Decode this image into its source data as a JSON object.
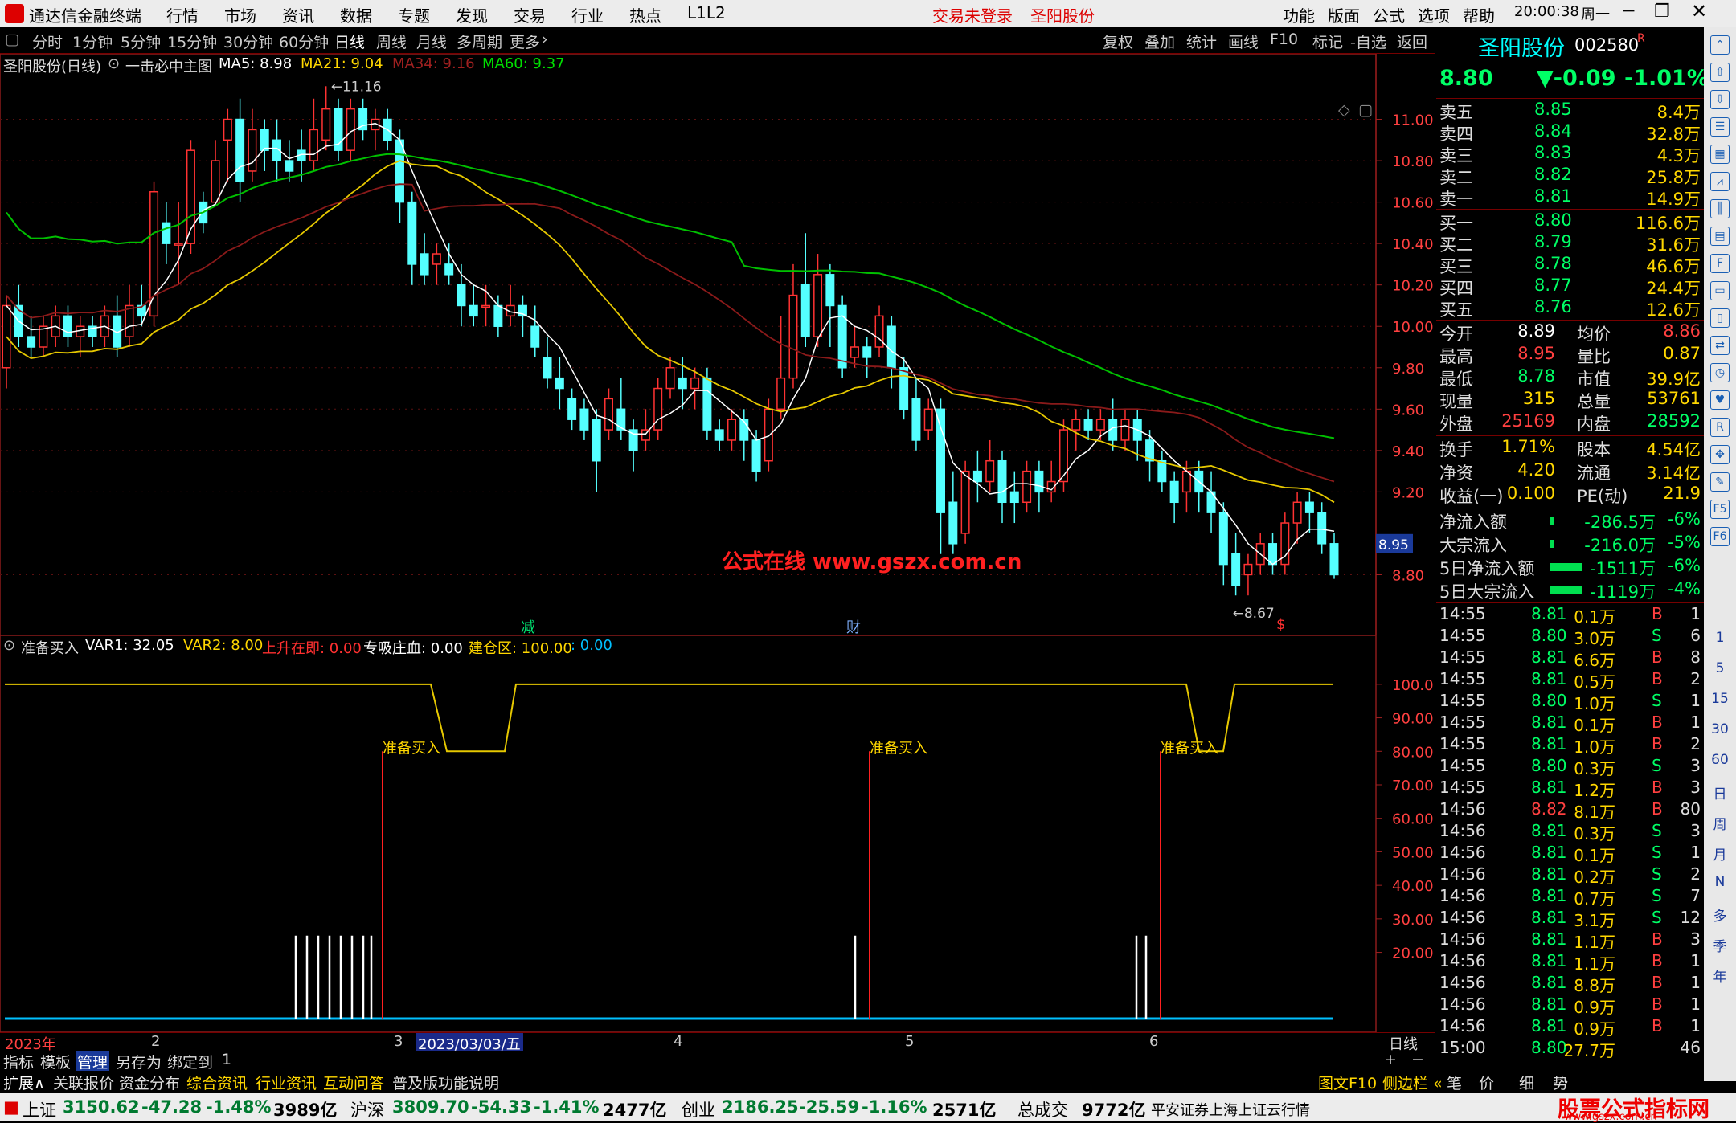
{
  "titlebar": {
    "app_name": "通达信金融终端",
    "menu": [
      "行情",
      "市场",
      "资讯",
      "数据",
      "专题",
      "发现",
      "交易",
      "行业",
      "热点",
      "L1L2"
    ],
    "login_status": "交易未登录",
    "stock_name": "圣阳股份",
    "right_menu": [
      "功能",
      "版面",
      "公式",
      "选项",
      "帮助"
    ],
    "time": "20:00:38",
    "weekday": "周一"
  },
  "periods": [
    "分时",
    "1分钟",
    "5分钟",
    "15分钟",
    "30分钟",
    "60分钟",
    "日线",
    "周线",
    "月线",
    "多周期",
    "更多"
  ],
  "selected_period": "日线",
  "toolbar": [
    "复权",
    "叠加",
    "统计",
    "画线",
    "F10",
    "标记",
    "-自选",
    "返回"
  ],
  "main_legend": {
    "title": "圣阳股份(日线)",
    "indicator": "一击必中主图",
    "ma5": "MA5: 8.98",
    "ma21": "MA21: 9.04",
    "ma34": "MA34: 9.16",
    "ma60": "MA60: 9.37"
  },
  "price_axis": [
    "11.00",
    "10.80",
    "10.60",
    "10.40",
    "10.20",
    "10.00",
    "9.80",
    "9.60",
    "9.40",
    "9.20",
    "8.80"
  ],
  "current_price_tag": "8.95",
  "high_label": "11.16",
  "low_label": "8.67",
  "watermark": "公式在线  www.gszx.com.cn",
  "event_marks": {
    "jian": "减",
    "cai": "财"
  },
  "sub_legend": {
    "name": "准备买入",
    "var1": "VAR1: 32.05",
    "var2": "VAR2: 8.00",
    "up": "上升在即: 0.00",
    "absorb": "专吸庄血: 0.00",
    "build": "建仓区: 100.00",
    "extra": ": 0.00"
  },
  "sub_axis": [
    "100.0",
    "90.00",
    "80.00",
    "70.00",
    "60.00",
    "50.00",
    "40.00",
    "30.00",
    "20.00"
  ],
  "buy_signal_label": "准备买入",
  "timeline": {
    "year": "2023年",
    "m2": "2",
    "m3": "3",
    "highlight": "2023/03/03/五",
    "m4": "4",
    "m5": "5",
    "m6": "6",
    "period": "日线"
  },
  "tabs": [
    "指标",
    "模板",
    "管理",
    "另存为",
    "绑定到",
    "1"
  ],
  "ext_tabs": [
    "扩展∧",
    "关联报价",
    "资金分布",
    "综合资讯",
    "行业资讯",
    "互动问答",
    "普及版功能说明"
  ],
  "ext_right": [
    "图文F10",
    "侧边栏 «",
    "笔",
    "价",
    "细",
    "势"
  ],
  "quote": {
    "name": "圣阳股份",
    "code": "002580",
    "flag": "R",
    "price": "8.80",
    "change": "▼-0.09",
    "pct": "-1.01%",
    "sell": [
      [
        "卖五",
        "8.85",
        "8.4万"
      ],
      [
        "卖四",
        "8.84",
        "32.8万"
      ],
      [
        "卖三",
        "8.83",
        "4.3万"
      ],
      [
        "卖二",
        "8.82",
        "25.8万"
      ],
      [
        "卖一",
        "8.81",
        "14.9万"
      ]
    ],
    "buy": [
      [
        "买一",
        "8.80",
        "116.6万"
      ],
      [
        "买二",
        "8.79",
        "31.6万"
      ],
      [
        "买三",
        "8.78",
        "46.6万"
      ],
      [
        "买四",
        "8.77",
        "24.4万"
      ],
      [
        "买五",
        "8.76",
        "12.6万"
      ]
    ],
    "stats": [
      [
        "今开",
        "8.89",
        "均价",
        "8.86"
      ],
      [
        "最高",
        "8.95",
        "量比",
        "0.87"
      ],
      [
        "最低",
        "8.78",
        "市值",
        "39.9亿"
      ],
      [
        "现量",
        "315",
        "总量",
        "53761"
      ],
      [
        "外盘",
        "25169",
        "内盘",
        "28592"
      ]
    ],
    "stats2": [
      [
        "换手",
        "1.71%",
        "股本",
        "4.54亿"
      ],
      [
        "净资",
        "4.20",
        "流通",
        "3.14亿"
      ],
      [
        "收益(一)",
        "0.100",
        "PE(动)",
        "21.9"
      ]
    ],
    "flows": [
      [
        "净流入额",
        "-286.5万",
        "-6%"
      ],
      [
        "大宗流入",
        "-216.0万",
        "-5%"
      ],
      [
        "5日净流入额",
        "-1511万",
        "-6%"
      ],
      [
        "5日大宗流入",
        "-1119万",
        "-4%"
      ]
    ],
    "ticks": [
      [
        "14:55",
        "8.81",
        "0.1万",
        "B",
        "1"
      ],
      [
        "14:55",
        "8.80",
        "3.0万",
        "S",
        "6"
      ],
      [
        "14:55",
        "8.81",
        "6.6万",
        "B",
        "8"
      ],
      [
        "14:55",
        "8.81",
        "0.5万",
        "B",
        "2"
      ],
      [
        "14:55",
        "8.80",
        "1.0万",
        "S",
        "1"
      ],
      [
        "14:55",
        "8.81",
        "0.1万",
        "B",
        "1"
      ],
      [
        "14:55",
        "8.81",
        "1.0万",
        "B",
        "2"
      ],
      [
        "14:55",
        "8.80",
        "0.3万",
        "S",
        "3"
      ],
      [
        "14:55",
        "8.81",
        "1.2万",
        "B",
        "3"
      ],
      [
        "14:56",
        "8.82",
        "8.1万",
        "B",
        "80"
      ],
      [
        "14:56",
        "8.81",
        "0.3万",
        "S",
        "3"
      ],
      [
        "14:56",
        "8.81",
        "0.1万",
        "S",
        "1"
      ],
      [
        "14:56",
        "8.81",
        "0.2万",
        "S",
        "2"
      ],
      [
        "14:56",
        "8.81",
        "0.7万",
        "S",
        "7"
      ],
      [
        "14:56",
        "8.81",
        "3.1万",
        "S",
        "12"
      ],
      [
        "14:56",
        "8.81",
        "1.1万",
        "B",
        "3"
      ],
      [
        "14:56",
        "8.81",
        "1.1万",
        "B",
        "1"
      ],
      [
        "14:56",
        "8.81",
        "8.8万",
        "B",
        "1"
      ],
      [
        "14:56",
        "8.81",
        "0.9万",
        "B",
        "1"
      ],
      [
        "14:56",
        "8.81",
        "0.9万",
        "B",
        "1"
      ],
      [
        "15:00",
        "8.80",
        "27.7万",
        "",
        "46"
      ]
    ]
  },
  "side_text": [
    "1",
    "5",
    "15",
    "30",
    "60",
    "日",
    "周",
    "月",
    "N",
    "多",
    "季",
    "年"
  ],
  "status": {
    "sh_name": "上证",
    "sh_val": "3150.62",
    "sh_chg": "-47.28",
    "sh_pct": "-1.48%",
    "sh_amt": "3989亿",
    "hs_name": "沪深",
    "hs_val": "3809.70",
    "hs_chg": "-54.33",
    "hs_pct": "-1.41%",
    "hs_amt": "2477亿",
    "cy_name": "创业",
    "cy_val": "2186.25",
    "cy_chg": "-25.59",
    "cy_pct": "-1.16%",
    "cy_amt": "2571亿",
    "total_label": "总成交",
    "total_val": "9772亿",
    "server": "平安证券上海上证云行情",
    "brand": "股票公式指标网",
    "brand_url": "www.gszx.com.cn"
  },
  "chart_data": {
    "type": "candlestick",
    "y_range": [
      8.6,
      11.2
    ],
    "candles": [
      [
        9.8,
        10.1,
        10.15,
        9.7
      ],
      [
        10.1,
        9.95,
        10.2,
        9.9
      ],
      [
        9.95,
        9.9,
        10.05,
        9.85
      ],
      [
        9.9,
        10.0,
        10.05,
        9.85
      ],
      [
        9.95,
        10.05,
        10.1,
        9.9
      ],
      [
        10.05,
        9.95,
        10.1,
        9.9
      ],
      [
        9.95,
        10.0,
        10.05,
        9.85
      ],
      [
        10.0,
        9.95,
        10.05,
        9.9
      ],
      [
        9.95,
        10.05,
        10.1,
        9.9
      ],
      [
        10.05,
        9.9,
        10.15,
        9.85
      ],
      [
        9.95,
        10.1,
        10.2,
        9.9
      ],
      [
        10.1,
        10.05,
        10.2,
        10.0
      ],
      [
        10.05,
        10.65,
        10.7,
        10.0
      ],
      [
        10.5,
        10.4,
        10.6,
        10.3
      ],
      [
        10.4,
        10.4,
        10.6,
        10.2
      ],
      [
        10.4,
        10.85,
        10.9,
        10.35
      ],
      [
        10.6,
        10.5,
        10.65,
        10.45
      ],
      [
        10.6,
        10.8,
        10.9,
        10.6
      ],
      [
        10.9,
        11.0,
        11.05,
        10.7
      ],
      [
        11.0,
        10.7,
        11.1,
        10.6
      ],
      [
        10.75,
        10.95,
        11.05,
        10.7
      ],
      [
        10.95,
        10.85,
        11.0,
        10.75
      ],
      [
        10.9,
        10.8,
        11.0,
        10.7
      ],
      [
        10.8,
        10.75,
        10.9,
        10.7
      ],
      [
        10.85,
        10.8,
        10.95,
        10.7
      ],
      [
        10.8,
        10.95,
        11.1,
        10.75
      ],
      [
        10.9,
        11.05,
        11.16,
        10.85
      ],
      [
        11.05,
        10.85,
        11.1,
        10.8
      ],
      [
        10.85,
        11.05,
        11.1,
        10.8
      ],
      [
        11.05,
        10.95,
        11.1,
        10.9
      ],
      [
        10.95,
        11.0,
        11.05,
        10.85
      ],
      [
        11.0,
        10.9,
        11.05,
        10.85
      ],
      [
        10.9,
        10.6,
        10.95,
        10.5
      ],
      [
        10.6,
        10.3,
        10.65,
        10.2
      ],
      [
        10.35,
        10.25,
        10.45,
        10.2
      ],
      [
        10.3,
        10.35,
        10.4,
        10.2
      ],
      [
        10.3,
        10.25,
        10.4,
        10.2
      ],
      [
        10.2,
        10.1,
        10.3,
        10.0
      ],
      [
        10.1,
        10.05,
        10.2,
        10.0
      ],
      [
        10.1,
        10.1,
        10.2,
        10.0
      ],
      [
        10.1,
        10.0,
        10.15,
        9.95
      ],
      [
        10.05,
        10.1,
        10.2,
        10.0
      ],
      [
        10.1,
        10.05,
        10.15,
        9.95
      ],
      [
        10.0,
        9.9,
        10.1,
        9.85
      ],
      [
        9.85,
        9.75,
        9.95,
        9.7
      ],
      [
        9.75,
        9.7,
        9.85,
        9.6
      ],
      [
        9.65,
        9.55,
        9.7,
        9.5
      ],
      [
        9.6,
        9.5,
        9.65,
        9.45
      ],
      [
        9.55,
        9.35,
        9.6,
        9.2
      ],
      [
        9.5,
        9.65,
        9.7,
        9.45
      ],
      [
        9.6,
        9.5,
        9.75,
        9.45
      ],
      [
        9.5,
        9.4,
        9.55,
        9.3
      ],
      [
        9.45,
        9.5,
        9.6,
        9.4
      ],
      [
        9.5,
        9.7,
        9.75,
        9.45
      ],
      [
        9.7,
        9.8,
        9.85,
        9.65
      ],
      [
        9.75,
        9.7,
        9.85,
        9.6
      ],
      [
        9.7,
        9.75,
        9.8,
        9.6
      ],
      [
        9.75,
        9.5,
        9.8,
        9.45
      ],
      [
        9.5,
        9.45,
        9.55,
        9.4
      ],
      [
        9.45,
        9.55,
        9.6,
        9.4
      ],
      [
        9.55,
        9.45,
        9.6,
        9.35
      ],
      [
        9.45,
        9.3,
        9.5,
        9.25
      ],
      [
        9.35,
        9.6,
        9.65,
        9.3
      ],
      [
        9.6,
        9.75,
        10.05,
        9.55
      ],
      [
        9.75,
        10.15,
        10.3,
        9.7
      ],
      [
        10.2,
        9.95,
        10.45,
        9.9
      ],
      [
        9.95,
        10.25,
        10.35,
        9.9
      ],
      [
        10.25,
        10.1,
        10.3,
        9.9
      ],
      [
        10.1,
        9.8,
        10.15,
        9.75
      ],
      [
        9.85,
        9.9,
        10.0,
        9.8
      ],
      [
        9.9,
        9.85,
        9.95,
        9.75
      ],
      [
        9.9,
        10.05,
        10.1,
        9.85
      ],
      [
        10.0,
        9.8,
        10.05,
        9.7
      ],
      [
        9.8,
        9.6,
        9.85,
        9.55
      ],
      [
        9.65,
        9.45,
        9.75,
        9.4
      ],
      [
        9.5,
        9.6,
        9.65,
        9.45
      ],
      [
        9.6,
        9.1,
        9.65,
        8.9
      ],
      [
        9.15,
        8.95,
        9.3,
        8.9
      ],
      [
        9.0,
        9.3,
        9.35,
        8.95
      ],
      [
        9.3,
        9.25,
        9.4,
        9.15
      ],
      [
        9.25,
        9.35,
        9.45,
        9.2
      ],
      [
        9.35,
        9.15,
        9.4,
        9.05
      ],
      [
        9.2,
        9.15,
        9.3,
        9.05
      ],
      [
        9.15,
        9.3,
        9.35,
        9.1
      ],
      [
        9.3,
        9.2,
        9.35,
        9.1
      ],
      [
        9.2,
        9.25,
        9.35,
        9.15
      ],
      [
        9.25,
        9.5,
        9.55,
        9.2
      ],
      [
        9.5,
        9.55,
        9.6,
        9.4
      ],
      [
        9.55,
        9.5,
        9.6,
        9.45
      ],
      [
        9.5,
        9.55,
        9.6,
        9.45
      ],
      [
        9.55,
        9.45,
        9.65,
        9.4
      ],
      [
        9.45,
        9.55,
        9.6,
        9.4
      ],
      [
        9.55,
        9.45,
        9.6,
        9.35
      ],
      [
        9.45,
        9.35,
        9.5,
        9.25
      ],
      [
        9.35,
        9.25,
        9.4,
        9.2
      ],
      [
        9.25,
        9.15,
        9.3,
        9.05
      ],
      [
        9.2,
        9.3,
        9.35,
        9.1
      ],
      [
        9.3,
        9.2,
        9.35,
        9.1
      ],
      [
        9.2,
        9.1,
        9.3,
        9.0
      ],
      [
        9.1,
        8.85,
        9.15,
        8.75
      ],
      [
        8.9,
        8.75,
        9.0,
        8.7
      ],
      [
        8.8,
        8.85,
        8.9,
        8.7
      ],
      [
        8.85,
        8.95,
        9.0,
        8.8
      ],
      [
        8.95,
        8.85,
        9.0,
        8.8
      ],
      [
        8.85,
        9.05,
        9.1,
        8.8
      ],
      [
        9.05,
        9.15,
        9.2,
        8.95
      ],
      [
        9.15,
        9.1,
        9.2,
        9.0
      ],
      [
        9.1,
        8.95,
        9.15,
        8.9
      ],
      [
        8.95,
        8.8,
        9.0,
        8.78
      ]
    ],
    "sub": {
      "y_range": [
        0,
        105
      ],
      "build_line": "100/80",
      "signals": [
        0.18,
        0.56,
        0.73
      ]
    }
  }
}
